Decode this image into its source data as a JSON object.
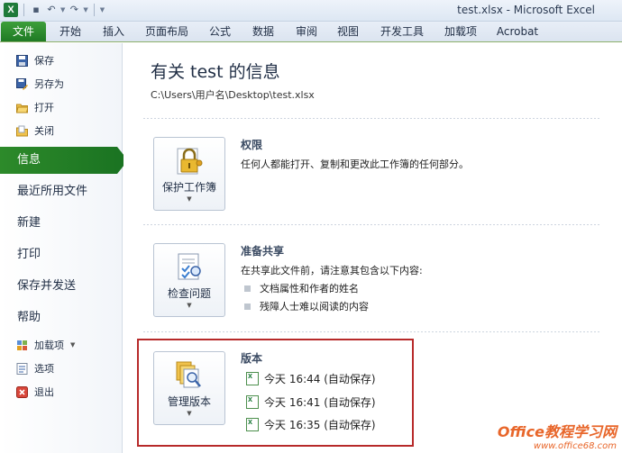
{
  "window": {
    "title": "test.xlsx  -  Microsoft Excel"
  },
  "qat": {
    "app_icon": "X"
  },
  "ribbon": {
    "tabs": [
      {
        "label": "文件"
      },
      {
        "label": "开始"
      },
      {
        "label": "插入"
      },
      {
        "label": "页面布局"
      },
      {
        "label": "公式"
      },
      {
        "label": "数据"
      },
      {
        "label": "审阅"
      },
      {
        "label": "视图"
      },
      {
        "label": "开发工具"
      },
      {
        "label": "加载项"
      },
      {
        "label": "Acrobat"
      }
    ]
  },
  "nav": {
    "small_top": [
      {
        "label": "保存",
        "icon": "save-icon"
      },
      {
        "label": "另存为",
        "icon": "save-as-icon"
      },
      {
        "label": "打开",
        "icon": "open-folder-icon"
      },
      {
        "label": "关闭",
        "icon": "close-folder-icon"
      }
    ],
    "big": [
      {
        "label": "信息"
      },
      {
        "label": "最近所用文件"
      },
      {
        "label": "新建"
      },
      {
        "label": "打印"
      },
      {
        "label": "保存并发送"
      },
      {
        "label": "帮助"
      }
    ],
    "small_bottom": [
      {
        "label": "加载项",
        "icon": "addins-icon"
      },
      {
        "label": "选项",
        "icon": "options-icon"
      },
      {
        "label": "退出",
        "icon": "exit-icon"
      }
    ]
  },
  "info": {
    "title": "有关 test 的信息",
    "path": "C:\\Users\\用户名\\Desktop\\test.xlsx",
    "permissions": {
      "button": "保护工作簿",
      "title": "权限",
      "desc": "任何人都能打开、复制和更改此工作簿的任何部分。"
    },
    "prepare": {
      "button": "检查问题",
      "title": "准备共享",
      "desc": "在共享此文件前，请注意其包含以下内容:",
      "bullets": [
        "文档属性和作者的姓名",
        "残障人士难以阅读的内容"
      ]
    },
    "versions": {
      "button": "管理版本",
      "title": "版本",
      "items": [
        "今天 16:44 (自动保存)",
        "今天 16:41 (自动保存)",
        "今天 16:35 (自动保存)"
      ]
    }
  },
  "watermark": {
    "line1": "Office教程学习网",
    "line2": "www.office68.com"
  },
  "colors": {
    "file_tab": "#2d8a2a",
    "highlight": "#b72a2a"
  }
}
